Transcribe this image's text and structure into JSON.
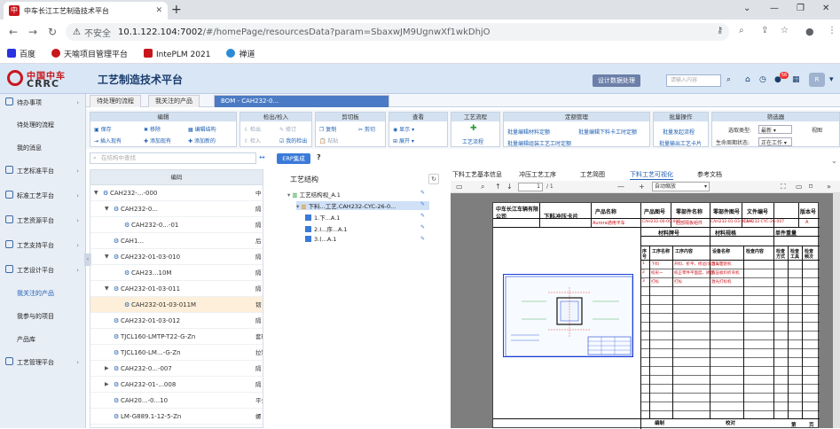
{
  "browser": {
    "tab_title": "中车长江工艺制造技术平台",
    "url_not_secure": "不安全",
    "url_host": "10.1.122.104:7002",
    "url_path": "/#/homePage/resourcesData?param=SbaxwJM9UgnwXf1wkDhjO",
    "bookmarks": [
      "百度",
      "天喻项目管理平台",
      "IntePLM 2021",
      "禅道"
    ]
  },
  "app": {
    "logo_cn": "中国中车",
    "logo_en": "CRRC",
    "system_title": "工艺制造技术平台",
    "header_button": "设计数据处理",
    "search_placeholder": "请输入内容",
    "notification_count": "56",
    "user_initial": "R"
  },
  "sidebar": {
    "items": [
      {
        "label": "待办事项",
        "type": "group"
      },
      {
        "label": "待处理的流程",
        "type": "sub"
      },
      {
        "label": "我的消息",
        "type": "sub"
      },
      {
        "label": "工艺标准平台",
        "type": "group"
      },
      {
        "label": "标准工艺平台",
        "type": "group"
      },
      {
        "label": "工艺资源平台",
        "type": "group"
      },
      {
        "label": "工艺支持平台",
        "type": "group"
      },
      {
        "label": "工艺设计平台",
        "type": "group"
      },
      {
        "label": "我关注的产品",
        "type": "sub-active"
      },
      {
        "label": "我参与的项目",
        "type": "sub"
      },
      {
        "label": "产品库",
        "type": "sub"
      },
      {
        "label": "工艺管理平台",
        "type": "group"
      }
    ]
  },
  "page_tabs": [
    "待处理的流程",
    "我关注的产品",
    "BOM - CAH232-0..."
  ],
  "toolbar": {
    "groups": [
      {
        "title": "编辑",
        "items": [
          "保存",
          "移除",
          "编辑结构",
          "插入现有",
          "添加现有",
          "添加新的"
        ]
      },
      {
        "title": "检出/检入",
        "items": [
          "检出",
          "修订",
          "检入",
          "我的检出"
        ]
      },
      {
        "title": "剪切板",
        "items": [
          "复制",
          "剪切",
          "粘贴"
        ]
      },
      {
        "title": "查看",
        "items": [
          "显示",
          "展开"
        ]
      },
      {
        "title": "工艺流程",
        "items": [
          "工艺流程"
        ]
      },
      {
        "title": "定额管理",
        "items": [
          "批量编辑材料定额",
          "批量编辑下料卡工时定额",
          "批量编辑组装工艺工时定额"
        ]
      },
      {
        "title": "批量操作",
        "items": [
          "批量发起流程",
          "批量输出工艺卡片"
        ]
      },
      {
        "title": "筛选器",
        "items": [
          "选取类型:",
          "最新",
          "视图",
          "生命周期状态:",
          "正在工作"
        ]
      }
    ]
  },
  "left_panel": {
    "search_placeholder": "在结构中查找",
    "erp_button": "ERP集成",
    "column_header": "编码",
    "rows": [
      {
        "code": "CAH232-...-000",
        "right": "中",
        "level": 0,
        "exp": "▼"
      },
      {
        "code": "CAH232-0...",
        "right": "隔",
        "level": 1,
        "exp": "▼"
      },
      {
        "code": "CAH232-0...-01",
        "right": "隔",
        "level": 2,
        "exp": ""
      },
      {
        "code": "CAH1...",
        "right": "后",
        "level": 1,
        "exp": ""
      },
      {
        "code": "CAH232-01-03-010",
        "right": "隔",
        "level": 1,
        "exp": "▼"
      },
      {
        "code": "CAH23...10M",
        "right": "隔",
        "level": 2,
        "exp": ""
      },
      {
        "code": "CAH232-01-03-011",
        "right": "隔",
        "level": 1,
        "exp": "▼"
      },
      {
        "code": "CAH232-01-03-011M",
        "right": "韧",
        "level": 2,
        "exp": "",
        "selected": true
      },
      {
        "code": "CAH232-01-03-012",
        "right": "隔",
        "level": 1,
        "exp": ""
      },
      {
        "code": "TJCL160-LMTP-T22-G-Zn",
        "right": "套环",
        "level": 1,
        "exp": ""
      },
      {
        "code": "TJCL160-LM...-G-Zn",
        "right": "拉钢",
        "level": 1,
        "exp": ""
      },
      {
        "code": "CAH232-0...-007",
        "right": "隔",
        "level": 1,
        "exp": "▶"
      },
      {
        "code": "CAH232-01-...008",
        "right": "隔",
        "level": 1,
        "exp": "▶"
      },
      {
        "code": "CAH20...-0...10",
        "right": "平头",
        "level": 1,
        "exp": ""
      },
      {
        "code": "LM-G889.1-12-5-Zn",
        "right": "螺",
        "level": 1,
        "exp": ""
      }
    ]
  },
  "structure": {
    "title": "工艺结构",
    "nodes": [
      {
        "label": "工艺结构视_A.1",
        "indent": 0,
        "highlight": false,
        "check": false
      },
      {
        "label": "下料...工艺.CAH232-CYC-26-0...",
        "indent": 1,
        "highlight": true,
        "check": false
      },
      {
        "label": "1.下...A.1",
        "indent": 2,
        "highlight": false,
        "check": true
      },
      {
        "label": "2.I...序...A.1",
        "indent": 2,
        "highlight": false,
        "check": true
      },
      {
        "label": "3.(...A.1",
        "indent": 2,
        "highlight": false,
        "check": true
      }
    ]
  },
  "viewer": {
    "tabs": [
      "下料工艺基本信息",
      "冲压工艺工序",
      "工艺简图",
      "下料工艺可视化",
      "参考文档"
    ],
    "active_tab": 3,
    "page_current": "1",
    "page_total": "/ 1",
    "zoom": "自动缩放"
  },
  "card": {
    "company": "中车长江车辆有限公司",
    "card_type": "下料冲压卡片",
    "headers": [
      "产品名称",
      "产品图号",
      "零部件名称",
      "零部件图号",
      "文件编号",
      "版本号"
    ],
    "values": [
      "Aurora通用平车",
      "CAH232-00-00-000",
      "后部隔板组件",
      "CAH232-01-03-011M",
      "CAH232-CYC-26-007",
      "A"
    ],
    "labels2": [
      "材料牌号",
      "材料规格",
      "单件重量"
    ],
    "op_headers": [
      "序号",
      "工序名称",
      "工序内容",
      "设备名称",
      "检查内容",
      "检查方式",
      "检查工具",
      "检查频次"
    ],
    "ops": [
      {
        "no": "1",
        "name": "下料",
        "content": "开料、折平、修边/清洁工艺",
        "device": "激光切割机"
      },
      {
        "no": "2",
        "name": "校形一",
        "content": "校正零件平面度、矫直...",
        "device": "液压板料折弯机"
      },
      {
        "no": "3",
        "name": "打标",
        "content": "打标",
        "device": "激光打标机"
      }
    ],
    "foot": [
      "编制",
      "校对",
      "第",
      "页"
    ]
  }
}
